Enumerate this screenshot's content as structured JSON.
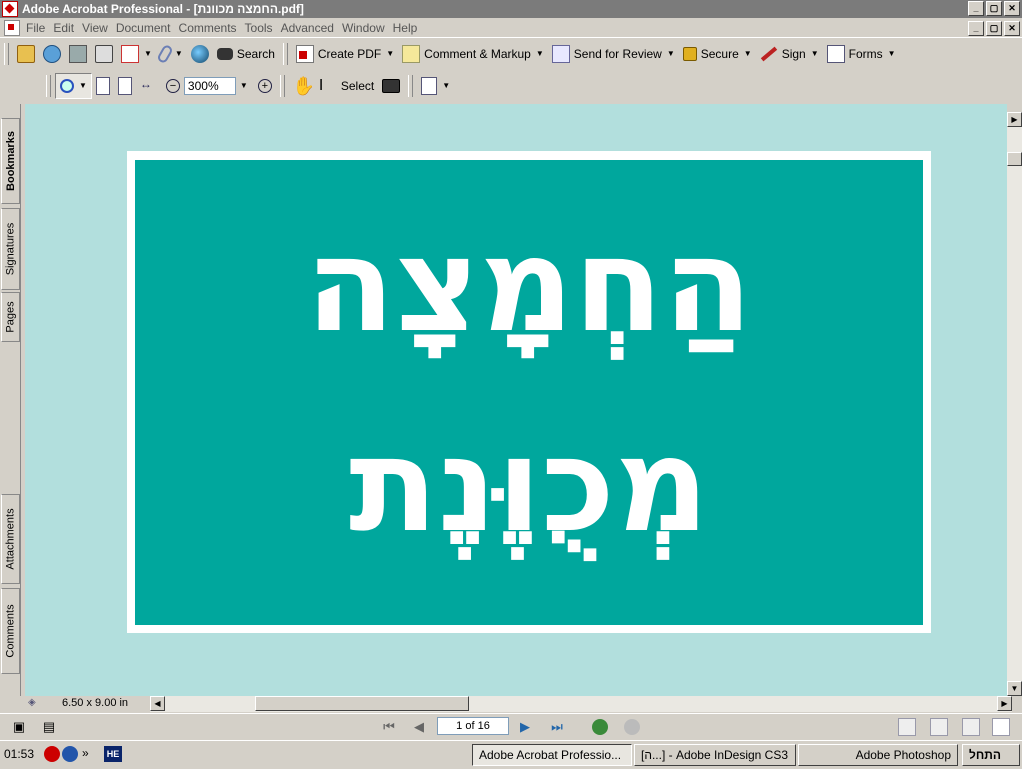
{
  "window": {
    "title": "Adobe Acrobat Professional - [החמצה מכוונת.pdf]",
    "controls": [
      "_",
      "▢",
      "✕"
    ]
  },
  "menu": [
    "File",
    "Edit",
    "View",
    "Document",
    "Comments",
    "Tools",
    "Advanced",
    "Window",
    "Help"
  ],
  "toolbar1": {
    "search_label": "Search",
    "create_pdf_label": "Create PDF",
    "comment_markup_label": "Comment & Markup",
    "send_review_label": "Send for Review",
    "secure_label": "Secure",
    "sign_label": "Sign",
    "forms_label": "Forms"
  },
  "toolbar2": {
    "zoom_value": "300%",
    "select_label": "Select"
  },
  "side_tabs": [
    "Bookmarks",
    "Signatures",
    "Pages",
    "Attachments",
    "Comments"
  ],
  "document": {
    "line1": "הַחְמָצָה",
    "line2": "מְכֻוֶּנֶת",
    "colors": {
      "page_bg": "#b2dfdd",
      "panel": "#00a79d",
      "text": "#ffffff"
    }
  },
  "status": {
    "page_size": "6.50 x 9.00 in",
    "page_indicator": "1 of 16"
  },
  "taskbar": {
    "clock": "01:53",
    "chevron": "»",
    "lang": "HE",
    "tasks": [
      "Adobe Acrobat Professio...",
      "[ה...] - Adobe InDesign CS3",
      "Adobe Photoshop",
      "התחל"
    ]
  }
}
